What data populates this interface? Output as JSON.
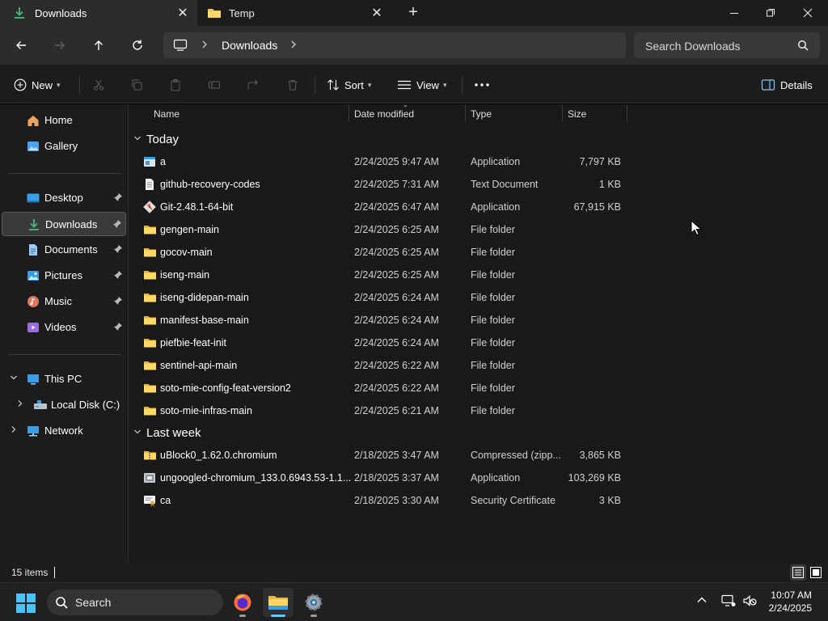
{
  "tabs": [
    {
      "title": "Downloads",
      "active": true
    },
    {
      "title": "Temp",
      "active": false
    }
  ],
  "address": {
    "crumbs": [
      "Downloads"
    ],
    "search_placeholder": "Search Downloads"
  },
  "commands": {
    "new_label": "New",
    "sort_label": "Sort",
    "view_label": "View",
    "details_label": "Details"
  },
  "sidebar": {
    "items": [
      {
        "label": "Home",
        "icon": "home-icon"
      },
      {
        "label": "Gallery",
        "icon": "gallery-icon"
      },
      {
        "label": "Desktop",
        "icon": "desktop-icon",
        "pinned": true
      },
      {
        "label": "Downloads",
        "icon": "download-icon",
        "pinned": true,
        "selected": true
      },
      {
        "label": "Documents",
        "icon": "documents-icon",
        "pinned": true
      },
      {
        "label": "Pictures",
        "icon": "pictures-icon",
        "pinned": true
      },
      {
        "label": "Music",
        "icon": "music-icon",
        "pinned": true
      },
      {
        "label": "Videos",
        "icon": "videos-icon",
        "pinned": true
      },
      {
        "label": "This PC",
        "icon": "pc-icon",
        "expanded": true
      },
      {
        "label": "Local Disk (C:)",
        "icon": "disk-icon"
      },
      {
        "label": "Network",
        "icon": "network-icon"
      }
    ]
  },
  "columns": {
    "name": "Name",
    "date": "Date modified",
    "type": "Type",
    "size": "Size"
  },
  "groups": [
    {
      "title": "Today",
      "rows": [
        {
          "name": "a",
          "date": "2/24/2025 9:47 AM",
          "type": "Application",
          "size": "7,797 KB",
          "icon": "app-icon"
        },
        {
          "name": "github-recovery-codes",
          "date": "2/24/2025 7:31 AM",
          "type": "Text Document",
          "size": "1 KB",
          "icon": "text-file-icon"
        },
        {
          "name": "Git-2.48.1-64-bit",
          "date": "2/24/2025 6:47 AM",
          "type": "Application",
          "size": "67,915 KB",
          "icon": "git-installer-icon"
        },
        {
          "name": "gengen-main",
          "date": "2/24/2025 6:25 AM",
          "type": "File folder",
          "size": "",
          "icon": "folder-icon"
        },
        {
          "name": "gocov-main",
          "date": "2/24/2025 6:25 AM",
          "type": "File folder",
          "size": "",
          "icon": "folder-icon"
        },
        {
          "name": "iseng-main",
          "date": "2/24/2025 6:25 AM",
          "type": "File folder",
          "size": "",
          "icon": "folder-icon"
        },
        {
          "name": "iseng-didepan-main",
          "date": "2/24/2025 6:24 AM",
          "type": "File folder",
          "size": "",
          "icon": "folder-icon"
        },
        {
          "name": "manifest-base-main",
          "date": "2/24/2025 6:24 AM",
          "type": "File folder",
          "size": "",
          "icon": "folder-icon"
        },
        {
          "name": "piefbie-feat-init",
          "date": "2/24/2025 6:24 AM",
          "type": "File folder",
          "size": "",
          "icon": "folder-icon"
        },
        {
          "name": "sentinel-api-main",
          "date": "2/24/2025 6:22 AM",
          "type": "File folder",
          "size": "",
          "icon": "folder-icon"
        },
        {
          "name": "soto-mie-config-feat-version2",
          "date": "2/24/2025 6:22 AM",
          "type": "File folder",
          "size": "",
          "icon": "folder-icon"
        },
        {
          "name": "soto-mie-infras-main",
          "date": "2/24/2025 6:21 AM",
          "type": "File folder",
          "size": "",
          "icon": "folder-icon"
        }
      ]
    },
    {
      "title": "Last week",
      "rows": [
        {
          "name": "uBlock0_1.62.0.chromium",
          "date": "2/18/2025 3:47 AM",
          "type": "Compressed (zipp...",
          "size": "3,865 KB",
          "icon": "zip-icon"
        },
        {
          "name": "ungoogled-chromium_133.0.6943.53-1.1...",
          "date": "2/18/2025 3:37 AM",
          "type": "Application",
          "size": "103,269 KB",
          "icon": "installer-icon"
        },
        {
          "name": "ca",
          "date": "2/18/2025 3:30 AM",
          "type": "Security Certificate",
          "size": "3 KB",
          "icon": "certificate-icon"
        }
      ]
    }
  ],
  "status": {
    "items_count": "15 items"
  },
  "taskbar": {
    "search_label": "Search",
    "time": "10:07 AM",
    "date": "2/24/2025"
  },
  "colors": {
    "accent": "#5ec8ff",
    "folder": "#f4c64e",
    "download_green": "#3fbf7f"
  }
}
